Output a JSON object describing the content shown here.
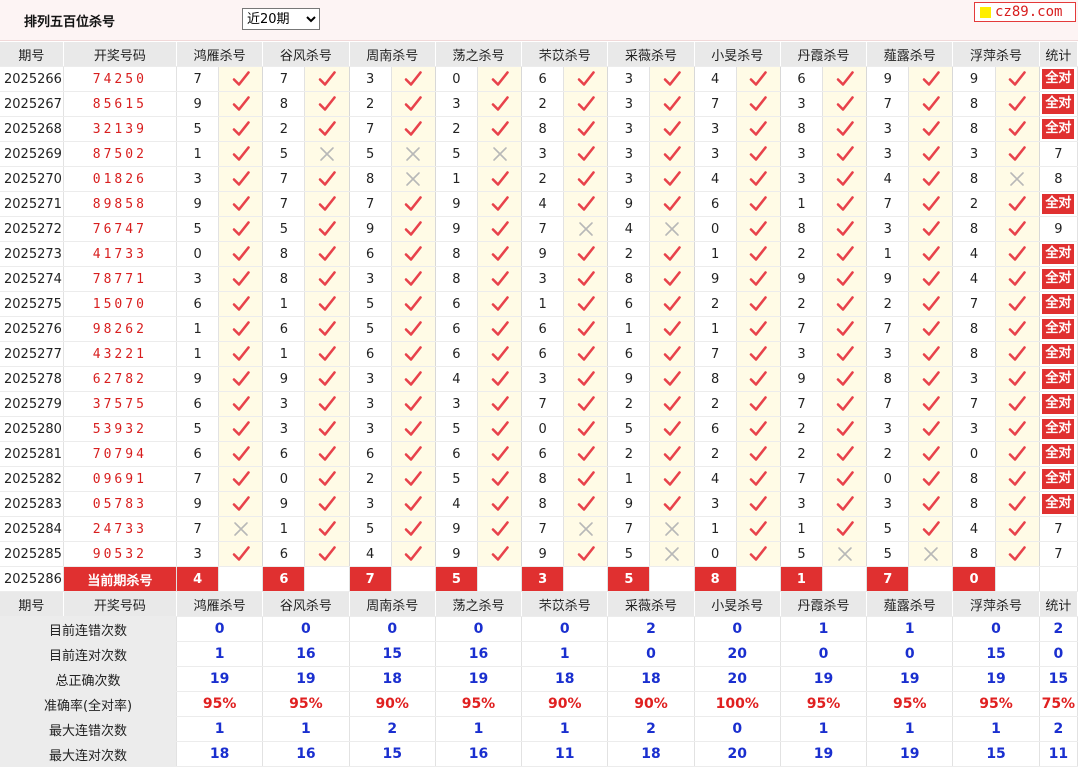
{
  "header": {
    "title": "排列五百位杀号",
    "period_select": "近20期",
    "brand": "cz89.com"
  },
  "table": {
    "col_period": "期号",
    "col_draw": "开奖号码",
    "col_stat": "统计",
    "experts": [
      "鸿雁杀号",
      "谷风杀号",
      "周南杀号",
      "荡之杀号",
      "芣苡杀号",
      "采薇杀号",
      "小旻杀号",
      "丹霞杀号",
      "薤露杀号",
      "浮萍杀号"
    ],
    "all_correct_label": "全对",
    "rows": [
      {
        "period": "2025266",
        "draw": "74250",
        "kills": [
          "7",
          "7",
          "3",
          "0",
          "6",
          "3",
          "4",
          "6",
          "9",
          "9"
        ],
        "marks": [
          1,
          1,
          1,
          1,
          1,
          1,
          1,
          1,
          1,
          1
        ],
        "stat": "全对"
      },
      {
        "period": "2025267",
        "draw": "85615",
        "kills": [
          "9",
          "8",
          "2",
          "3",
          "2",
          "3",
          "7",
          "3",
          "7",
          "8"
        ],
        "marks": [
          1,
          1,
          1,
          1,
          1,
          1,
          1,
          1,
          1,
          1
        ],
        "stat": "全对"
      },
      {
        "period": "2025268",
        "draw": "32139",
        "kills": [
          "5",
          "2",
          "7",
          "2",
          "8",
          "3",
          "3",
          "8",
          "3",
          "8"
        ],
        "marks": [
          1,
          1,
          1,
          1,
          1,
          1,
          1,
          1,
          1,
          1
        ],
        "stat": "全对"
      },
      {
        "period": "2025269",
        "draw": "87502",
        "kills": [
          "1",
          "5",
          "5",
          "5",
          "3",
          "3",
          "3",
          "3",
          "3",
          "3"
        ],
        "marks": [
          1,
          0,
          0,
          0,
          1,
          1,
          1,
          1,
          1,
          1
        ],
        "stat": "7"
      },
      {
        "period": "2025270",
        "draw": "01826",
        "kills": [
          "3",
          "7",
          "8",
          "1",
          "2",
          "3",
          "4",
          "3",
          "4",
          "8"
        ],
        "marks": [
          1,
          1,
          0,
          1,
          1,
          1,
          1,
          1,
          1,
          0
        ],
        "stat": "8"
      },
      {
        "period": "2025271",
        "draw": "89858",
        "kills": [
          "9",
          "7",
          "7",
          "9",
          "4",
          "9",
          "6",
          "1",
          "7",
          "2"
        ],
        "marks": [
          1,
          1,
          1,
          1,
          1,
          1,
          1,
          1,
          1,
          1
        ],
        "stat": "全对"
      },
      {
        "period": "2025272",
        "draw": "76747",
        "kills": [
          "5",
          "5",
          "9",
          "9",
          "7",
          "4",
          "0",
          "8",
          "3",
          "8"
        ],
        "marks": [
          1,
          1,
          1,
          1,
          0,
          0,
          1,
          1,
          1,
          1
        ],
        "stat": "9"
      },
      {
        "period": "2025273",
        "draw": "41733",
        "kills": [
          "0",
          "8",
          "6",
          "8",
          "9",
          "2",
          "1",
          "2",
          "1",
          "4"
        ],
        "marks": [
          1,
          1,
          1,
          1,
          1,
          1,
          1,
          1,
          1,
          1
        ],
        "stat": "全对"
      },
      {
        "period": "2025274",
        "draw": "78771",
        "kills": [
          "3",
          "8",
          "3",
          "8",
          "3",
          "8",
          "9",
          "9",
          "9",
          "4"
        ],
        "marks": [
          1,
          1,
          1,
          1,
          1,
          1,
          1,
          1,
          1,
          1
        ],
        "stat": "全对"
      },
      {
        "period": "2025275",
        "draw": "15070",
        "kills": [
          "6",
          "1",
          "5",
          "6",
          "1",
          "6",
          "2",
          "2",
          "2",
          "7"
        ],
        "marks": [
          1,
          1,
          1,
          1,
          1,
          1,
          1,
          1,
          1,
          1
        ],
        "stat": "全对"
      },
      {
        "period": "2025276",
        "draw": "98262",
        "kills": [
          "1",
          "6",
          "5",
          "6",
          "6",
          "1",
          "1",
          "7",
          "7",
          "8"
        ],
        "marks": [
          1,
          1,
          1,
          1,
          1,
          1,
          1,
          1,
          1,
          1
        ],
        "stat": "全对"
      },
      {
        "period": "2025277",
        "draw": "43221",
        "kills": [
          "1",
          "1",
          "6",
          "6",
          "6",
          "6",
          "7",
          "3",
          "3",
          "8"
        ],
        "marks": [
          1,
          1,
          1,
          1,
          1,
          1,
          1,
          1,
          1,
          1
        ],
        "stat": "全对"
      },
      {
        "period": "2025278",
        "draw": "62782",
        "kills": [
          "9",
          "9",
          "3",
          "4",
          "3",
          "9",
          "8",
          "9",
          "8",
          "3"
        ],
        "marks": [
          1,
          1,
          1,
          1,
          1,
          1,
          1,
          1,
          1,
          1
        ],
        "stat": "全对"
      },
      {
        "period": "2025279",
        "draw": "37575",
        "kills": [
          "6",
          "3",
          "3",
          "3",
          "7",
          "2",
          "2",
          "7",
          "7",
          "7"
        ],
        "marks": [
          1,
          1,
          1,
          1,
          1,
          1,
          1,
          1,
          1,
          1
        ],
        "stat": "全对"
      },
      {
        "period": "2025280",
        "draw": "53932",
        "kills": [
          "5",
          "3",
          "3",
          "5",
          "0",
          "5",
          "6",
          "2",
          "3",
          "3"
        ],
        "marks": [
          1,
          1,
          1,
          1,
          1,
          1,
          1,
          1,
          1,
          1
        ],
        "stat": "全对"
      },
      {
        "period": "2025281",
        "draw": "70794",
        "kills": [
          "6",
          "6",
          "6",
          "6",
          "6",
          "2",
          "2",
          "2",
          "2",
          "0"
        ],
        "marks": [
          1,
          1,
          1,
          1,
          1,
          1,
          1,
          1,
          1,
          1
        ],
        "stat": "全对"
      },
      {
        "period": "2025282",
        "draw": "09691",
        "kills": [
          "7",
          "0",
          "2",
          "5",
          "8",
          "1",
          "4",
          "7",
          "0",
          "8"
        ],
        "marks": [
          1,
          1,
          1,
          1,
          1,
          1,
          1,
          1,
          1,
          1
        ],
        "stat": "全对"
      },
      {
        "period": "2025283",
        "draw": "05783",
        "kills": [
          "9",
          "9",
          "3",
          "4",
          "8",
          "9",
          "3",
          "3",
          "3",
          "8"
        ],
        "marks": [
          1,
          1,
          1,
          1,
          1,
          1,
          1,
          1,
          1,
          1
        ],
        "stat": "全对"
      },
      {
        "period": "2025284",
        "draw": "24733",
        "kills": [
          "7",
          "1",
          "5",
          "9",
          "7",
          "7",
          "1",
          "1",
          "5",
          "4"
        ],
        "marks": [
          0,
          1,
          1,
          1,
          0,
          0,
          1,
          1,
          1,
          1
        ],
        "stat": "7"
      },
      {
        "period": "2025285",
        "draw": "90532",
        "kills": [
          "3",
          "6",
          "4",
          "9",
          "9",
          "5",
          "0",
          "5",
          "5",
          "8"
        ],
        "marks": [
          1,
          1,
          1,
          1,
          1,
          0,
          1,
          0,
          0,
          1
        ],
        "stat": "7"
      }
    ],
    "current": {
      "period": "2025286",
      "label": "当前期杀号",
      "kills": [
        "4",
        "6",
        "7",
        "5",
        "3",
        "5",
        "8",
        "1",
        "7",
        "0"
      ]
    },
    "summary": [
      {
        "label": "目前连错次数",
        "color": "blue",
        "values": [
          "0",
          "0",
          "0",
          "0",
          "0",
          "2",
          "0",
          "1",
          "1",
          "0"
        ],
        "stat": "2"
      },
      {
        "label": "目前连对次数",
        "color": "blue",
        "values": [
          "1",
          "16",
          "15",
          "16",
          "1",
          "0",
          "20",
          "0",
          "0",
          "15"
        ],
        "stat": "0"
      },
      {
        "label": "总正确次数",
        "color": "blue",
        "values": [
          "19",
          "19",
          "18",
          "19",
          "18",
          "18",
          "20",
          "19",
          "19",
          "19"
        ],
        "stat": "15"
      },
      {
        "label": "准确率(全对率)",
        "color": "red",
        "values": [
          "95%",
          "95%",
          "90%",
          "95%",
          "90%",
          "90%",
          "100%",
          "95%",
          "95%",
          "95%"
        ],
        "stat": "75%"
      },
      {
        "label": "最大连错次数",
        "color": "blue",
        "values": [
          "1",
          "1",
          "2",
          "1",
          "1",
          "2",
          "0",
          "1",
          "1",
          "1"
        ],
        "stat": "2"
      },
      {
        "label": "最大连对次数",
        "color": "blue",
        "values": [
          "18",
          "16",
          "15",
          "16",
          "11",
          "18",
          "20",
          "19",
          "19",
          "15"
        ],
        "stat": "11"
      }
    ]
  },
  "colors": {
    "accent_red": "#e03030",
    "check_red": "#e8424b",
    "cross_grey": "#b8b8b8",
    "stat_blue": "#1a2fcf",
    "header_bg": "#e9e9e9",
    "mark_bg": "#fffbe6"
  },
  "icons": {
    "correct": "check-mark-icon",
    "wrong": "cross-mark-icon",
    "brand": "yellow-square-icon"
  }
}
